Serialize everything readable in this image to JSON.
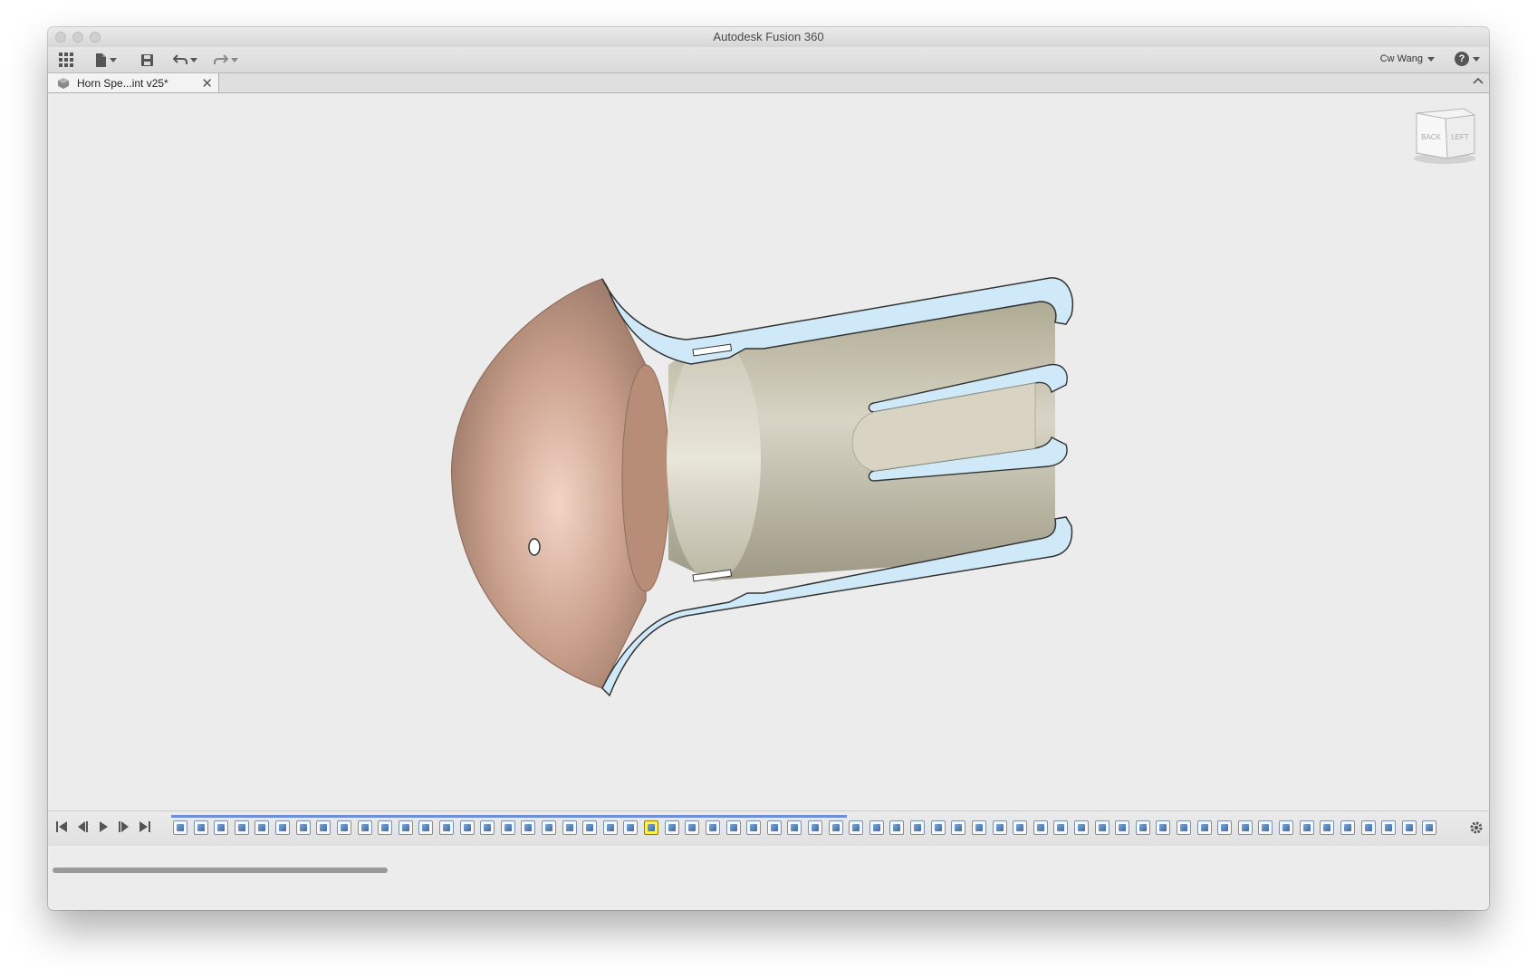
{
  "window": {
    "title": "Autodesk Fusion 360"
  },
  "toolbar": {
    "data_panel_icon": "grid-icon",
    "file_icon": "file-icon",
    "save_icon": "save-icon",
    "undo_icon": "undo-icon",
    "redo_icon": "redo-icon",
    "user_name": "Cw Wang",
    "help_label": "?"
  },
  "document_tab": {
    "title": "Horn Spe...int v25*",
    "close_label": "✕"
  },
  "viewcube": {
    "face_back": "BACK",
    "face_left": "LEFT"
  },
  "timeline": {
    "controls": [
      "go-to-start-icon",
      "step-back-icon",
      "play-icon",
      "step-forward-icon",
      "go-to-end-icon"
    ],
    "feature_count": 62,
    "highlighted_feature_index": 23,
    "settings_icon": "gear-icon"
  },
  "colors": {
    "section_fill": "#cfe9f8",
    "bell_copper": "#c49c86",
    "tube_beige": "#c6c1ae",
    "timeline_accent": "#6e8fd8",
    "highlight": "#fff14b"
  }
}
